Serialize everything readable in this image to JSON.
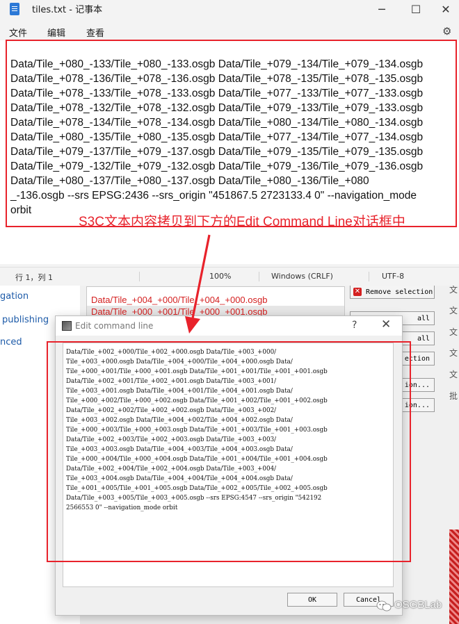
{
  "notepad": {
    "title": "tiles.txt - 记事本",
    "menu": [
      "文件",
      "编辑",
      "查看"
    ],
    "content_lines": [
      "Data/Tile_+080_-133/Tile_+080_-133.osgb Data/Tile_+079_-134/Tile_+079_-134.osgb",
      "Data/Tile_+078_-136/Tile_+078_-136.osgb Data/Tile_+078_-135/Tile_+078_-135.osgb",
      "Data/Tile_+078_-133/Tile_+078_-133.osgb Data/Tile_+077_-133/Tile_+077_-133.osgb",
      "Data/Tile_+078_-132/Tile_+078_-132.osgb Data/Tile_+079_-133/Tile_+079_-133.osgb",
      "Data/Tile_+078_-134/Tile_+078_-134.osgb Data/Tile_+080_-134/Tile_+080_-134.osgb",
      "Data/Tile_+080_-135/Tile_+080_-135.osgb Data/Tile_+077_-134/Tile_+077_-134.osgb",
      "Data/Tile_+079_-137/Tile_+079_-137.osgb Data/Tile_+079_-135/Tile_+079_-135.osgb",
      "Data/Tile_+079_-132/Tile_+079_-132.osgb Data/Tile_+079_-136/Tile_+079_-136.osgb",
      "Data/Tile_+080_-137/Tile_+080_-137.osgb Data/Tile_+080_-136/Tile_+080",
      "_-136.osgb --srs EPSG:2436 --srs_origin \"451867.5 2723133.4 0\" --navigation_mode",
      "orbit"
    ],
    "annotation": "S3C文本内容拷贝到下方的Edit Command Line对话框中",
    "status": {
      "position": "行 1，列 1",
      "zoom": "100%",
      "line_ending": "Windows (CRLF)",
      "encoding": "UTF-8"
    }
  },
  "background": {
    "left_links": [
      "gation",
      "publishing",
      "nced"
    ],
    "list_rows": [
      "Data/Tile_+004_+000/Tile_+004_+000.osgb",
      "Data/Tile_+000_+001/Tile_+000_+001.osgb"
    ],
    "buttons": [
      "Remove selection",
      "all",
      "all",
      "ection",
      "ion...",
      "ion..."
    ],
    "right_chars": [
      "文",
      "文",
      "文",
      "文",
      "文",
      "批"
    ]
  },
  "dialog": {
    "title": "Edit command line",
    "help": "?",
    "close": "✕",
    "content_lines": [
      "Data/Tile_+002_+000/Tile_+002_+000.osgb Data/Tile_+003_+000/",
      "Tile_+003_+000.osgb Data/Tile_+004_+000/Tile_+004_+000.osgb Data/",
      "Tile_+000_+001/Tile_+000_+001.osgb Data/Tile_+001_+001/Tile_+001_+001.osgb",
      "Data/Tile_+002_+001/Tile_+002_+001.osgb Data/Tile_+003_+001/",
      "Tile_+003_+001.osgb Data/Tile_+004_+001/Tile_+004_+001.osgb Data/",
      "Tile_+000_+002/Tile_+000_+002.osgb Data/Tile_+001_+002/Tile_+001_+002.osgb",
      "Data/Tile_+002_+002/Tile_+002_+002.osgb Data/Tile_+003_+002/",
      "Tile_+003_+002.osgb Data/Tile_+004_+002/Tile_+004_+002.osgb Data/",
      "Tile_+000_+003/Tile_+000_+003.osgb Data/Tile_+001_+003/Tile_+001_+003.osgb",
      "Data/Tile_+002_+003/Tile_+002_+003.osgb Data/Tile_+003_+003/",
      "Tile_+003_+003.osgb Data/Tile_+004_+003/Tile_+004_+003.osgb Data/",
      "Tile_+000_+004/Tile_+000_+004.osgb Data/Tile_+001_+004/Tile_+001_+004.osgb",
      "Data/Tile_+002_+004/Tile_+002_+004.osgb Data/Tile_+003_+004/",
      "Tile_+003_+004.osgb Data/Tile_+004_+004/Tile_+004_+004.osgb Data/",
      "Tile_+001_+005/Tile_+001_+005.osgb Data/Tile_+002_+005/Tile_+002_+005.osgb",
      "Data/Tile_+003_+005/Tile_+003_+005.osgb --srs EPSG:4547 --srs_origin \"542192",
      "2566553 0\" --navigation_mode orbit"
    ],
    "ok_label": "OK",
    "cancel_label": "Cancel"
  },
  "watermark": "OSGBLab",
  "colors": {
    "annotation_red": "#e8222b",
    "list_red": "#d42020",
    "link_blue": "#1c5aa8"
  }
}
